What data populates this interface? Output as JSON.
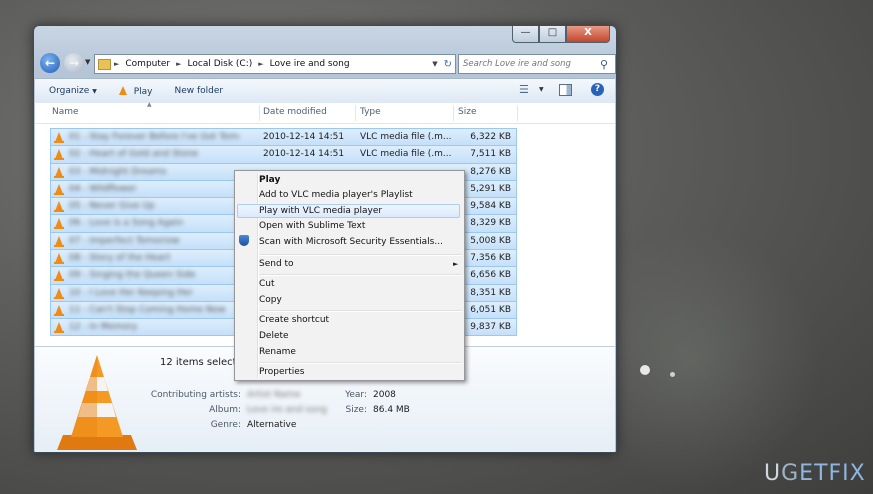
{
  "window": {
    "controls": {
      "minimize": "—",
      "maximize": "□",
      "close": "X"
    }
  },
  "address": {
    "segments": [
      "Computer",
      "Local Disk (C:)",
      "Love ire and song"
    ]
  },
  "search": {
    "placeholder": "Search Love ire and song"
  },
  "toolbar": {
    "organize": "Organize",
    "play": "Play",
    "new_folder": "New folder"
  },
  "columns": {
    "name": "Name",
    "date": "Date modified",
    "type": "Type",
    "size": "Size"
  },
  "files": [
    {
      "name": "01 - Stay Forever Before I've Got Tomorrow",
      "date": "2010-12-14 14:51",
      "type": "VLC media file (.m...",
      "size": "6,322 KB"
    },
    {
      "name": "02 - Heart of Gold and Stone",
      "date": "2010-12-14 14:51",
      "type": "VLC media file (.m...",
      "size": "7,511 KB"
    },
    {
      "name": "03 - Midnight Dreams",
      "date": "",
      "type": "",
      "size": "8,276 KB"
    },
    {
      "name": "04 - Wildflower",
      "date": "",
      "type": "",
      "size": "5,291 KB"
    },
    {
      "name": "05 - Never Give Up",
      "date": "",
      "type": "",
      "size": "9,584 KB"
    },
    {
      "name": "06 - Love is a Song Again",
      "date": "",
      "type": "",
      "size": "8,329 KB"
    },
    {
      "name": "07 - Imperfect Tomorrow",
      "date": "",
      "type": "",
      "size": "5,008 KB"
    },
    {
      "name": "08 - Story of the Heart",
      "date": "",
      "type": "",
      "size": "7,356 KB"
    },
    {
      "name": "09 - Singing the Queen Side",
      "date": "",
      "type": "",
      "size": "6,656 KB"
    },
    {
      "name": "10 - I Love Her Keeping Her",
      "date": "",
      "type": "",
      "size": "8,351 KB"
    },
    {
      "name": "11 - Can't Stop Coming Home Now",
      "date": "",
      "type": "",
      "size": "6,051 KB"
    },
    {
      "name": "12 - In Memory",
      "date": "",
      "type": "",
      "size": "9,837 KB"
    }
  ],
  "details": {
    "summary": "12 items selected",
    "contributing_label": "Contributing artists:",
    "contributing_value": "Artist Name",
    "album_label": "Album:",
    "album_value": "Love ire and song",
    "genre_label": "Genre:",
    "genre_value": "Alternative",
    "year_label": "Year:",
    "year_value": "2008",
    "size_label": "Size:",
    "size_value": "86.4 MB"
  },
  "context_menu": {
    "play": "Play",
    "add_playlist": "Add to VLC media player's Playlist",
    "play_with_vlc": "Play with VLC media player",
    "open_sublime": "Open with Sublime Text",
    "scan": "Scan with Microsoft Security Essentials...",
    "send_to": "Send to",
    "cut": "Cut",
    "copy": "Copy",
    "create_shortcut": "Create shortcut",
    "delete": "Delete",
    "rename": "Rename",
    "properties": "Properties"
  },
  "watermark": {
    "left": "U",
    "middle": "G",
    "right": "ETFIX"
  },
  "colors": {
    "selection": "#cce4f9",
    "accent_orange": "#f08c14",
    "window_frame": "#b5c5d7"
  }
}
